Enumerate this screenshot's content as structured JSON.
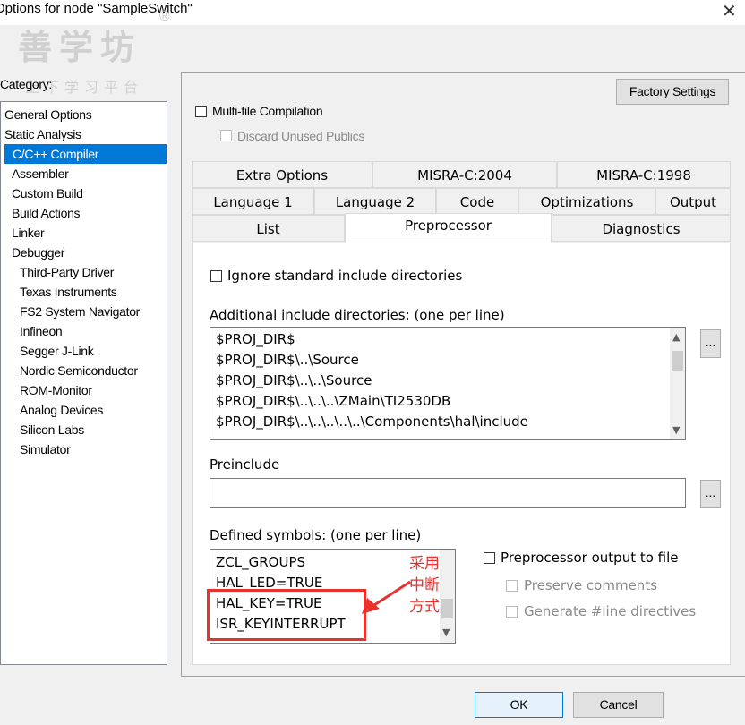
{
  "window": {
    "title": "Options for node \"SampleSwitch\"",
    "close_glyph": "✕"
  },
  "watermark": {
    "main": "善学坊",
    "reg": "®",
    "sub": "上下学习平台"
  },
  "category": {
    "label": "Category:",
    "items": [
      {
        "label": "General Options",
        "indent": 0,
        "selected": false
      },
      {
        "label": "Static Analysis",
        "indent": 0,
        "selected": false
      },
      {
        "label": "C/C++ Compiler",
        "indent": 1,
        "selected": true
      },
      {
        "label": "Assembler",
        "indent": 1,
        "selected": false
      },
      {
        "label": "Custom Build",
        "indent": 1,
        "selected": false
      },
      {
        "label": "Build Actions",
        "indent": 1,
        "selected": false
      },
      {
        "label": "Linker",
        "indent": 1,
        "selected": false
      },
      {
        "label": "Debugger",
        "indent": 1,
        "selected": false
      },
      {
        "label": "Third-Party Driver",
        "indent": 2,
        "selected": false
      },
      {
        "label": "Texas Instruments",
        "indent": 2,
        "selected": false
      },
      {
        "label": "FS2 System Navigator",
        "indent": 2,
        "selected": false
      },
      {
        "label": "Infineon",
        "indent": 2,
        "selected": false
      },
      {
        "label": "Segger J-Link",
        "indent": 2,
        "selected": false
      },
      {
        "label": "Nordic Semiconductor",
        "indent": 2,
        "selected": false
      },
      {
        "label": "ROM-Monitor",
        "indent": 2,
        "selected": false
      },
      {
        "label": "Analog Devices",
        "indent": 2,
        "selected": false
      },
      {
        "label": "Silicon Labs",
        "indent": 2,
        "selected": false
      },
      {
        "label": "Simulator",
        "indent": 2,
        "selected": false
      }
    ]
  },
  "main": {
    "factory_settings": "Factory Settings",
    "multifile": {
      "label": "Multi-file Compilation",
      "checked": false
    },
    "discard": {
      "label": "Discard Unused Publics",
      "checked": false,
      "disabled": true
    },
    "tabs_row1": [
      "Extra Options",
      "MISRA-C:2004",
      "MISRA-C:1998"
    ],
    "tabs_row2": [
      "Language 1",
      "Language 2",
      "Code",
      "Optimizations",
      "Output"
    ],
    "tabs_row3": [
      "List",
      "Preprocessor",
      "Diagnostics"
    ],
    "active_tab": "Preprocessor"
  },
  "preprocessor": {
    "ignore_std": {
      "label": "Ignore standard include directories",
      "checked": false
    },
    "include_label": "Additional include directories: (one per line)",
    "include_dirs": [
      "$PROJ_DIR$",
      "$PROJ_DIR$\\..\\Source",
      "$PROJ_DIR$\\..\\..\\Source",
      "$PROJ_DIR$\\..\\..\\..\\ZMain\\TI2530DB",
      "$PROJ_DIR$\\..\\..\\..\\..\\..\\Components\\hal\\include"
    ],
    "browse_glyph": "...",
    "preinclude_label": "Preinclude",
    "preinclude_value": "",
    "defined_label": "Defined symbols: (one per line)",
    "defined_symbols": [
      "ZCL_GROUPS",
      "HAL_LED=TRUE",
      "HAL_KEY=TRUE",
      "ISR_KEYINTERRUPT"
    ],
    "pp_output": {
      "label": "Preprocessor output to file",
      "checked": false
    },
    "preserve_comments": {
      "label": "Preserve comments",
      "checked": false,
      "disabled": true
    },
    "generate_line": {
      "label": "Generate #line directives",
      "checked": false,
      "disabled": true
    }
  },
  "annotation": {
    "lines": [
      "采用",
      "中断",
      "方式"
    ],
    "color": "#e8322e"
  },
  "buttons": {
    "ok": "OK",
    "cancel": "Cancel"
  }
}
